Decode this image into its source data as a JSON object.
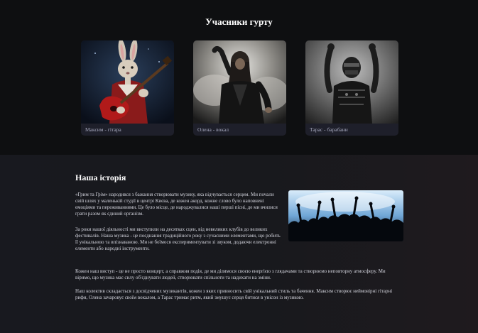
{
  "members_section": {
    "title": "Учасники гурту",
    "members": [
      {
        "caption": "Максим - гітара",
        "photo_icon": "rabbit-guitarist-photo"
      },
      {
        "caption": "Олена - вокал",
        "photo_icon": "rock-vocalist-photo"
      },
      {
        "caption": "Тарас - барабани",
        "photo_icon": "masked-drummer-photo"
      }
    ]
  },
  "history_section": {
    "title": "Наша історія",
    "paragraphs": [
      "«Грим та Грім» народився з бажання створювати музику, яка відчувається серцем. Ми почали свій шлях у маленькій студії в центрі Києва, де кожен акорд, кожне слово було наповнені емоціями та переживаннями. Це було місце, де народжувалися наші перші пісні, де ми вчилися грати разом як єдиний організм.",
      "За роки нашої діяльності ми виступили на десятках сцен, від невеликих клубів до великих фестивалів. Наша музика - це поєднання традиційного року з сучасними елементами, що робить її унікальною та впізнаваною. Ми не боїмося експериментувати зі звуком, додаючи електронні елементи або народні інструменти.",
      "Кожен наш виступ - це не просто концерт, а справжня подія, де ми ділимося своєю енергією з глядачами та створюємо неповторну атмосферу. Ми віримо, що музика має силу об'єднувати людей, створювати спільноти та надихати на зміни.",
      "Наш колектив складається з досвідчених музикантів, кожен з яких привносить свій унікальний стиль та бачення. Максим створює неймовірні гітарні рифи, Олена зачаровує своїм вокалом, а Тарас тримає ритм, який змушує серця битися в унісон із музикою."
    ],
    "image_icon": "concert-crowd-photo"
  }
}
